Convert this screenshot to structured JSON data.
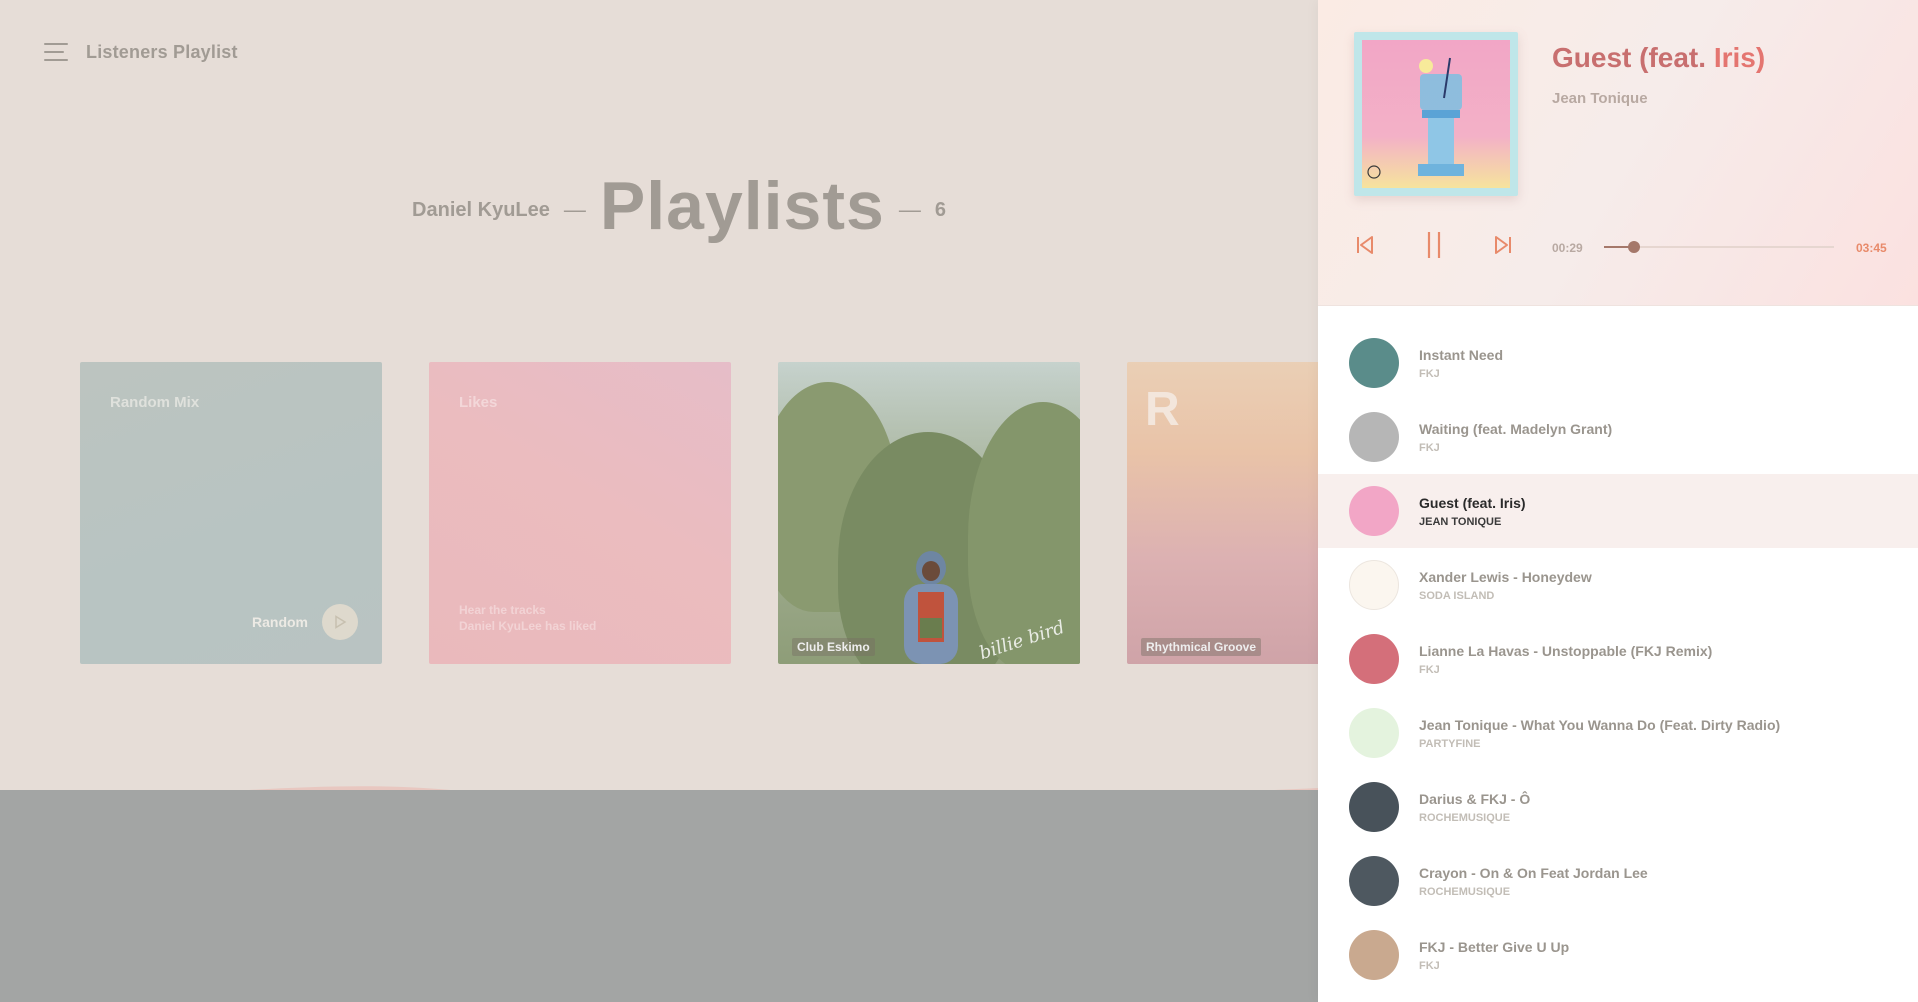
{
  "app": {
    "title": "Listeners Playlist"
  },
  "header": {
    "owner": "Daniel KyuLee",
    "dash1": "—",
    "title": "Playlists",
    "dash2": "—",
    "count": "6"
  },
  "cards": [
    {
      "title": "Random Mix",
      "action_label": "Random"
    },
    {
      "title": "Likes",
      "desc_line1": "Hear the tracks",
      "desc_line2": "Daniel KyuLee has liked"
    },
    {
      "tag": "Club Eskimo",
      "signature": "billie bird"
    },
    {
      "letter": "R",
      "tag": "Rhythmical Groove"
    }
  ],
  "now_playing": {
    "title": "Guest (feat. ",
    "title_feat": "Iris)",
    "artist": "Jean Tonique",
    "time_current": "00:29",
    "time_total": "03:45",
    "progress": 0.129
  },
  "tracks": [
    {
      "title": "Instant Need",
      "artist": "FKJ",
      "thumb_color": "#5a8c8a"
    },
    {
      "title": "Waiting (feat. Madelyn Grant)",
      "artist": "FKJ",
      "thumb_color": "#b6b6b6"
    },
    {
      "title": "Guest (feat. Iris)",
      "artist": "JEAN TONIQUE",
      "thumb_color": "#f2a6c6"
    },
    {
      "title": "Xander Lewis - Honeydew",
      "artist": "SODA ISLAND",
      "thumb_color": "#fbf6ef"
    },
    {
      "title": "Lianne La Havas - Unstoppable (FKJ Remix)",
      "artist": "FKJ",
      "thumb_color": "#d46f7a"
    },
    {
      "title": "Jean Tonique - What You Wanna Do (Feat. Dirty Radio)",
      "artist": "PARTYFINE",
      "thumb_color": "#e4f3de"
    },
    {
      "title": "Darius & FKJ - Ô",
      "artist": "ROCHEMUSIQUE",
      "thumb_color": "#48525a"
    },
    {
      "title": "Crayon - On & On Feat Jordan Lee",
      "artist": "ROCHEMUSIQUE",
      "thumb_color": "#4e5860"
    },
    {
      "title": "FKJ - Better Give U Up",
      "artist": "FKJ",
      "thumb_color": "#c9a98f"
    }
  ],
  "colors": {
    "accent": "#e47570",
    "active_row": "#f8efed",
    "progress": "#a5786a"
  }
}
